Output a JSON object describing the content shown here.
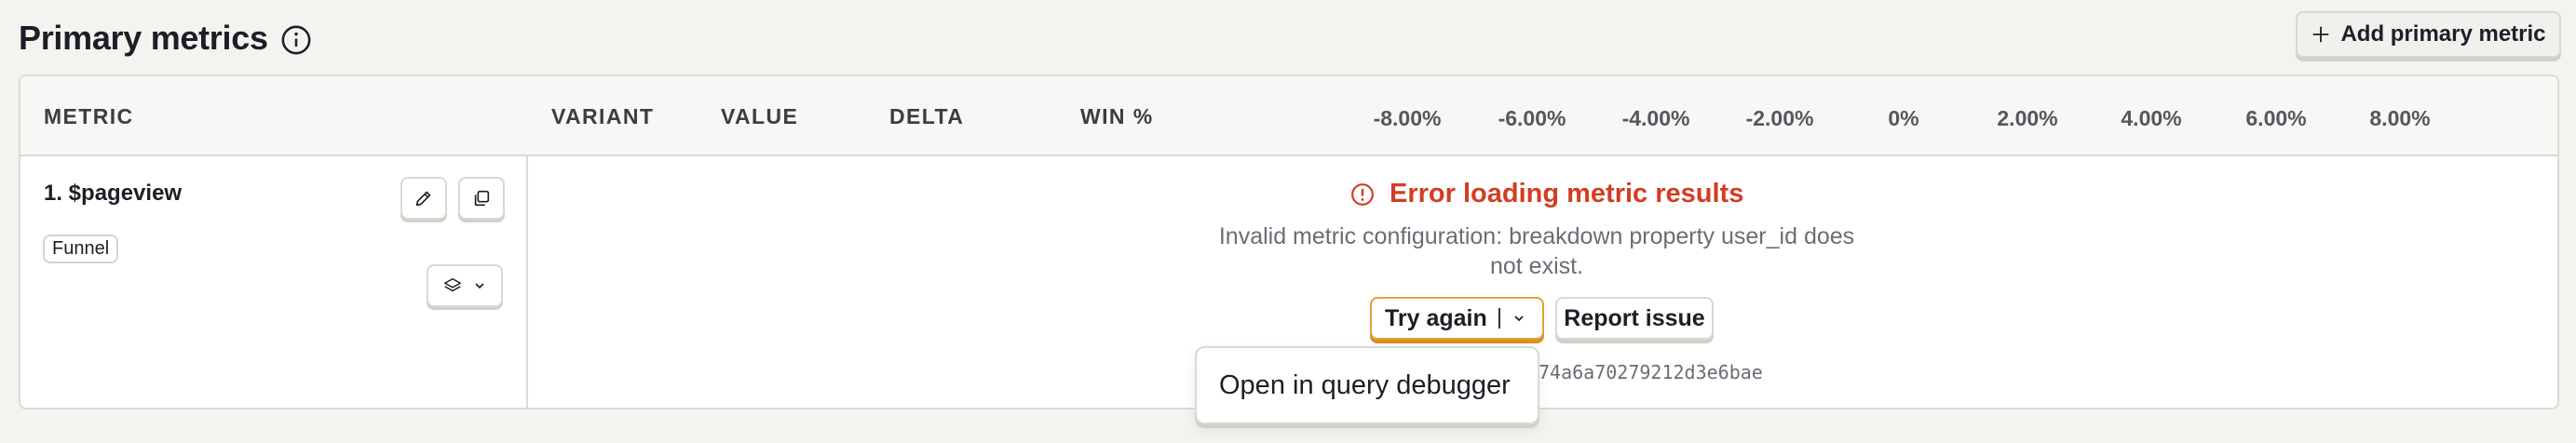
{
  "section": {
    "title": "Primary metrics",
    "add_button_label": "Add primary metric"
  },
  "table": {
    "columns": [
      "METRIC",
      "VARIANT",
      "VALUE",
      "DELTA",
      "WIN %"
    ],
    "axis_ticks": [
      "-8.00%",
      "-6.00%",
      "-4.00%",
      "-2.00%",
      "0%",
      "2.00%",
      "4.00%",
      "6.00%",
      "8.00%"
    ]
  },
  "metric": {
    "name": "1. $pageview",
    "type_badge": "Funnel"
  },
  "error": {
    "title": "Error loading metric results",
    "message": "Invalid metric configuration: breakdown property user_id does not exist.",
    "try_again_label": "Try again",
    "report_label": "Report issue",
    "query_id_fragment": "74a6a70279212d3e6bae"
  },
  "menu": {
    "open_debugger_label": "Open in query debugger"
  },
  "colors": {
    "error": "#d13e23",
    "accent": "#e0a23b"
  }
}
